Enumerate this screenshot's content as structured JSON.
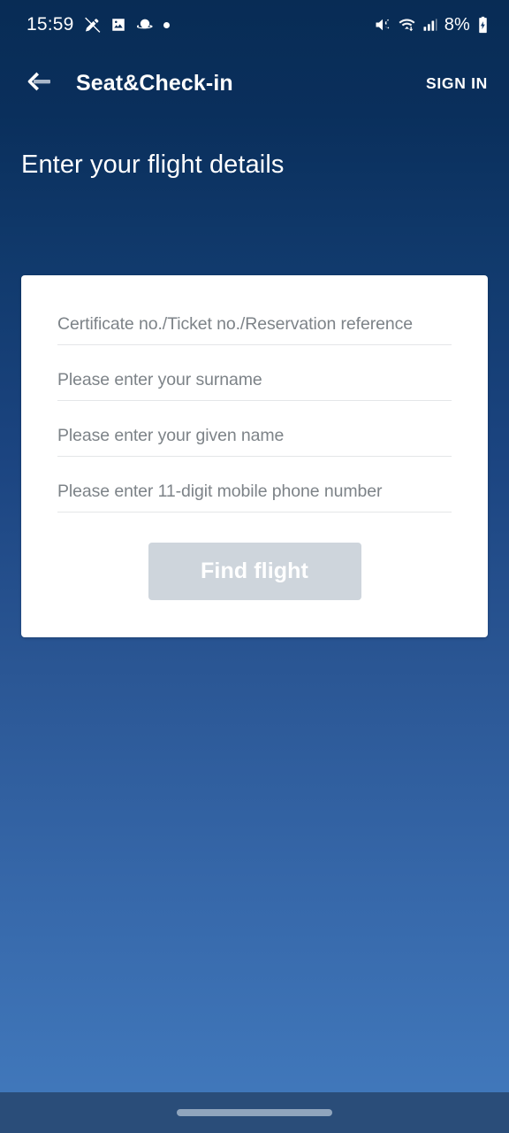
{
  "status_bar": {
    "time": "15:59",
    "battery_percent": "8%",
    "left_icons": [
      "pen-slash-icon",
      "image-icon",
      "saturn-icon",
      "dot-icon"
    ],
    "right_icons": [
      "volume-mute-icon",
      "wifi-transfer-icon",
      "cellular-signal-icon",
      "battery-charging-icon"
    ]
  },
  "app_bar": {
    "back_icon": "arrow-left-icon",
    "title": "Seat&Check-in",
    "sign_in_label": "SIGN IN"
  },
  "page": {
    "title": "Enter your flight details"
  },
  "form": {
    "fields": [
      {
        "name": "certificate-ticket-reservation",
        "placeholder": "Certificate no./Ticket no./Reservation reference",
        "value": ""
      },
      {
        "name": "surname",
        "placeholder": "Please enter your surname",
        "value": ""
      },
      {
        "name": "given-name",
        "placeholder": "Please enter your given name",
        "value": ""
      },
      {
        "name": "mobile-phone",
        "placeholder": "Please enter 11-digit mobile phone number",
        "value": ""
      }
    ],
    "submit_label": "Find flight",
    "submit_enabled": false
  },
  "navigation_bar": {
    "gesture_pill": "home-gesture-pill"
  },
  "colors": {
    "background_top": "#082c55",
    "background_bottom": "#4179bd",
    "card_background": "#ffffff",
    "field_underline": "#e4e6e8",
    "placeholder_text": "#7d8388",
    "submit_disabled": "#ced5dc",
    "nav_bar": "#2a4d79",
    "accent_text": "#ffffff"
  }
}
